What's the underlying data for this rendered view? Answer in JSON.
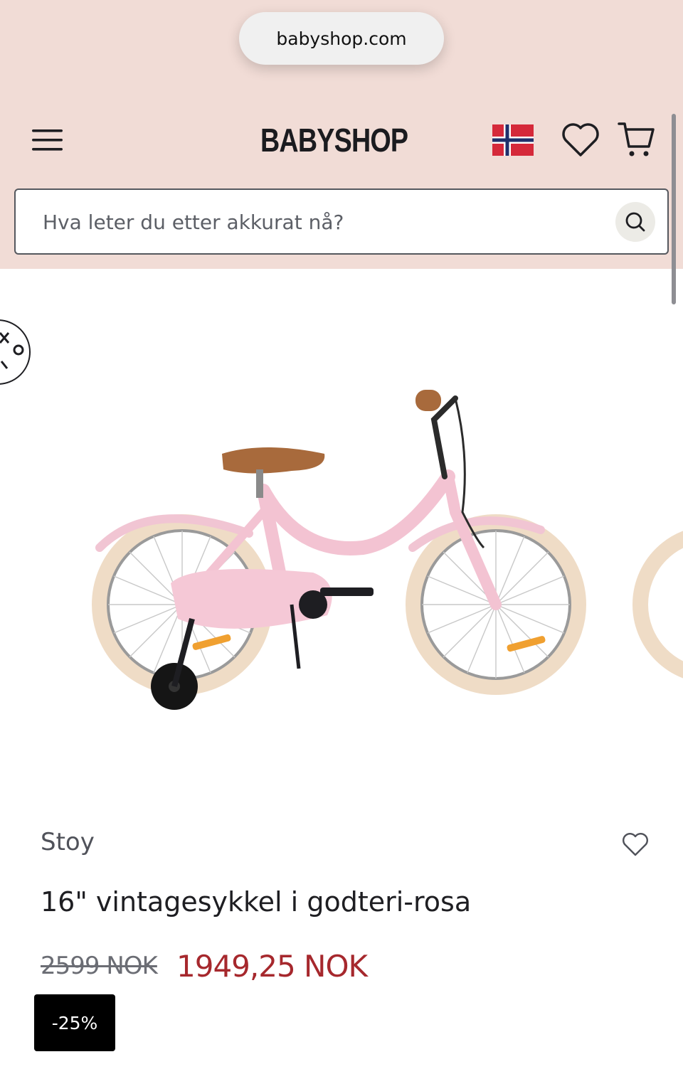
{
  "browser": {
    "url": "babyshop.com"
  },
  "header": {
    "logo_text": "BABYSHOP",
    "menu_icon": "hamburger-menu-icon",
    "flag_icon": "norway-flag-icon",
    "wishlist_icon": "heart-icon",
    "cart_icon": "shopping-cart-icon",
    "background_color": "#f1dcd6"
  },
  "search": {
    "placeholder": "Hva leter du etter akkurat nå?",
    "icon": "search-icon"
  },
  "product": {
    "brand": "Stoy",
    "title": "16\" vintagesykkel i godteri-rosa",
    "old_price": "2599 NOK",
    "new_price": "1949,25 NOK",
    "discount": "-25%",
    "price_color": "#a6282d",
    "favorite_icon": "heart-outline-icon",
    "image_icon": "pink-bicycle-image"
  }
}
